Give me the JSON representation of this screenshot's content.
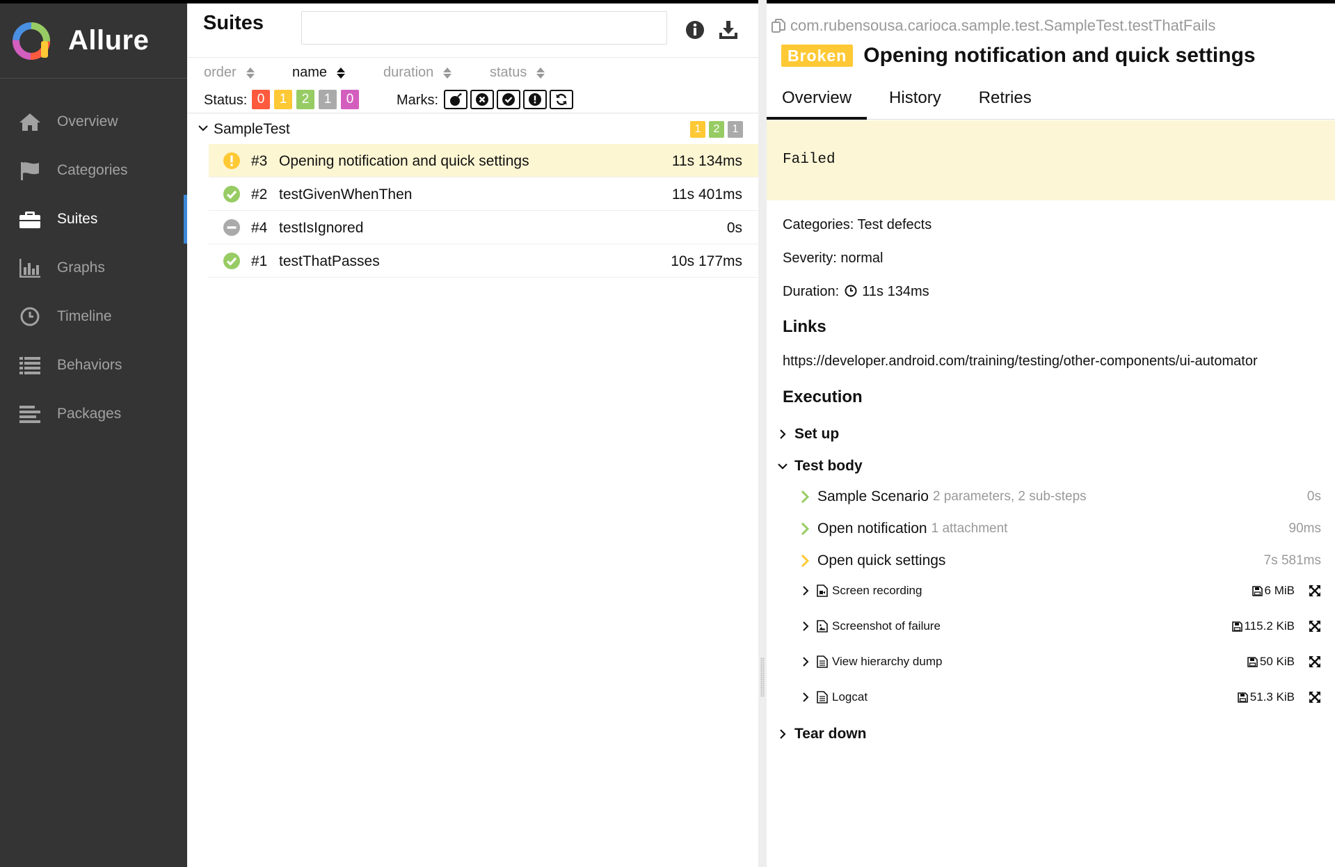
{
  "brand": {
    "name": "Allure"
  },
  "sidebar": {
    "items": [
      {
        "label": "Overview",
        "icon": "home-icon"
      },
      {
        "label": "Categories",
        "icon": "flag-icon"
      },
      {
        "label": "Suites",
        "icon": "briefcase-icon",
        "active": true
      },
      {
        "label": "Graphs",
        "icon": "bar-chart-icon"
      },
      {
        "label": "Timeline",
        "icon": "clock-icon"
      },
      {
        "label": "Behaviors",
        "icon": "list-icon"
      },
      {
        "label": "Packages",
        "icon": "align-left-icon"
      }
    ]
  },
  "suites_pane": {
    "title": "Suites",
    "search": {
      "value": "",
      "placeholder": ""
    },
    "sort": [
      "order",
      "name",
      "duration",
      "status"
    ],
    "sort_active": "name",
    "status_label": "Status:",
    "status_counts": [
      {
        "value": "0",
        "color": "#fd5a3e"
      },
      {
        "value": "1",
        "color": "#ffc935"
      },
      {
        "value": "2",
        "color": "#97cc64"
      },
      {
        "value": "1",
        "color": "#aaaaaa"
      },
      {
        "value": "0",
        "color": "#d35ebe"
      }
    ],
    "marks_label": "Marks:",
    "marks": [
      "bomb-icon",
      "times-circle-icon",
      "check-circle-icon",
      "exclamation-circle-icon",
      "refresh-icon"
    ],
    "group": {
      "name": "SampleTest",
      "badges": [
        {
          "value": "1",
          "color": "#ffc935"
        },
        {
          "value": "2",
          "color": "#97cc64"
        },
        {
          "value": "1",
          "color": "#aaaaaa"
        }
      ]
    },
    "tests": [
      {
        "num": "#3",
        "name": "Opening notification and quick settings",
        "duration": "11s 134ms",
        "status": "broken",
        "selected": true
      },
      {
        "num": "#2",
        "name": "testGivenWhenThen",
        "duration": "11s 401ms",
        "status": "passed"
      },
      {
        "num": "#4",
        "name": "testIsIgnored",
        "duration": "0s",
        "status": "skipped"
      },
      {
        "num": "#1",
        "name": "testThatPasses",
        "duration": "10s 177ms",
        "status": "passed"
      }
    ]
  },
  "details": {
    "full_name": "com.rubensousa.carioca.sample.test.SampleTest.testThatFails",
    "status_badge": "Broken",
    "title": "Opening notification and quick settings",
    "tabs": [
      "Overview",
      "History",
      "Retries"
    ],
    "active_tab": "Overview",
    "message": "Failed",
    "categories": "Categories: Test defects",
    "severity": "Severity: normal",
    "duration_label": "Duration:",
    "duration_value": "11s 134ms",
    "links_title": "Links",
    "link": "https://developer.android.com/training/testing/other-components/ui-automator",
    "execution_title": "Execution",
    "setup": "Set up",
    "test_body": "Test body",
    "teardown": "Tear down",
    "steps": [
      {
        "name": "Sample Scenario",
        "info": "2 parameters, 2 sub-steps",
        "duration": "0s",
        "color": "#97cc64"
      },
      {
        "name": "Open notification",
        "info": "1 attachment",
        "duration": "90ms",
        "color": "#97cc64"
      },
      {
        "name": "Open quick settings",
        "info": "",
        "duration": "7s 581ms",
        "color": "#ffc935"
      }
    ],
    "attachments": [
      {
        "name": "Screen recording",
        "size": "6 MiB",
        "icon": "video-file-icon"
      },
      {
        "name": "Screenshot of failure",
        "size": "115.2 KiB",
        "icon": "image-file-icon"
      },
      {
        "name": "View hierarchy dump",
        "size": "50 KiB",
        "icon": "text-file-icon"
      },
      {
        "name": "Logcat",
        "size": "51.3 KiB",
        "icon": "text-file-icon"
      }
    ]
  }
}
